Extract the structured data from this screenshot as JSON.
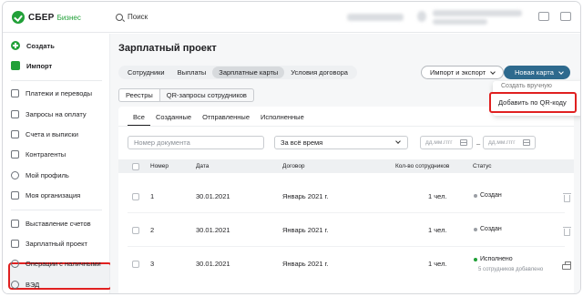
{
  "brand": {
    "name": "СБЕР",
    "product": "Бизнес",
    "accent": "#21a038"
  },
  "search": {
    "placeholder": "Поиск"
  },
  "sidebar": {
    "create": "Создать",
    "import": "Импорт",
    "items": [
      "Платежи и переводы",
      "Запросы на оплату",
      "Счета и выписки",
      "Контрагенты",
      "Мой профиль",
      "Моя организация"
    ],
    "items2": [
      "Выставление счетов",
      "Зарплатный проект",
      "Операции с наличными",
      "ВЭД"
    ],
    "active": "Зарплатный проект"
  },
  "page": {
    "title": "Зарплатный проект",
    "tabs": [
      "Сотрудники",
      "Выплаты",
      "Зарплатные карты",
      "Условия договора"
    ],
    "selected_tab": "Зарплатные карты",
    "import_export": "Импорт и экспорт",
    "new_card": "Новая карта",
    "dropdown": [
      "Создать вручную",
      "Добавить по QR-коду"
    ],
    "subtabs": [
      "Реестры",
      "QR-запросы сотрудников"
    ],
    "filter_tabs": [
      "Все",
      "Созданные",
      "Отправленные",
      "Исполненные"
    ],
    "doc_placeholder": "Номер документа",
    "period": "За всё время",
    "date_placeholder": "дд.мм.гггг",
    "date_dash": "–"
  },
  "table": {
    "headers": [
      "Номер",
      "Дата",
      "Договор",
      "Кол-во сотрудников",
      "Статус"
    ],
    "rows": [
      {
        "num": "1",
        "date": "30.01.2021",
        "contract": "Январь 2021 г.",
        "count": "1 чел.",
        "status": "Создан",
        "color": "#9a9ea4"
      },
      {
        "num": "2",
        "date": "30.01.2021",
        "contract": "Январь 2021 г.",
        "count": "1 чел.",
        "status": "Создан",
        "color": "#9a9ea4"
      },
      {
        "num": "3",
        "date": "30.01.2021",
        "contract": "Январь 2021 г.",
        "count": "1 чел.",
        "status": "Исполнено",
        "color": "#21a038",
        "sub": "5 сотрудников добавлено"
      }
    ]
  },
  "highlight_color": "#e02020",
  "primary_color": "#2e6a8e"
}
